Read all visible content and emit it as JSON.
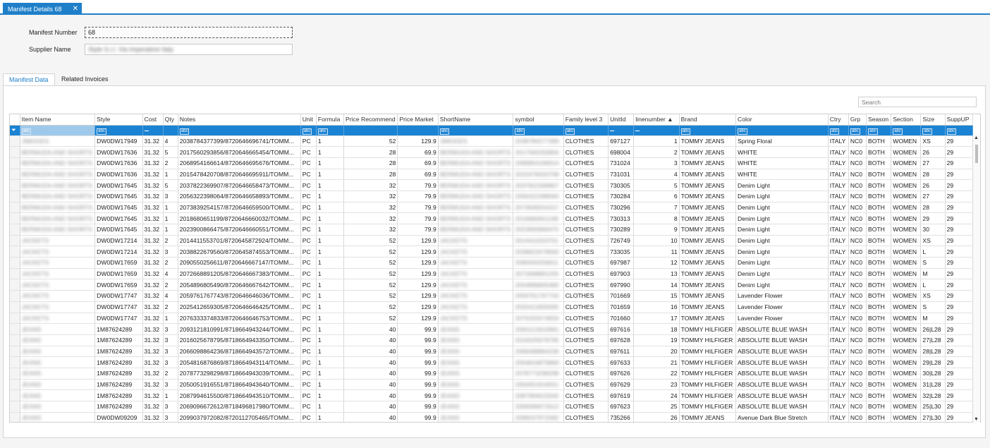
{
  "document_tab": {
    "label": "Manifest Details 68",
    "close": "✕"
  },
  "form": {
    "manifest_label": "Manifest Number",
    "manifest_value": "68",
    "supplier_label": "Supplier Name",
    "supplier_value": "Style S.r.l. Via Imperatore Italy"
  },
  "tabs": {
    "active": "Manifest Data",
    "inactive": "Related Invoices"
  },
  "search": {
    "placeholder": "Search"
  },
  "grid": {
    "columns": [
      "",
      "Item Name",
      "Style",
      "Cost",
      "Qty",
      "Notes",
      "Unit",
      "Formula",
      "Price Recommend",
      "Price Market",
      "ShortName",
      "symbol",
      "Family level 3",
      "UnitId",
      "linenumber ▲",
      "Brand",
      "Color",
      "Ctry",
      "Grp",
      "Season",
      "Section",
      "Size",
      "SuppUP"
    ],
    "filter_row": [
      "",
      "abc",
      "abc",
      "—",
      "",
      "abc",
      "abc",
      "abc",
      "",
      "",
      "abc",
      "abc",
      "abc",
      "—",
      "—",
      "abc",
      "abc",
      "abc",
      "abc",
      "abc",
      "abc",
      "abc",
      "abc"
    ],
    "rows": [
      [
        "",
        "JIMOGES",
        "DW0DW17949",
        "31.32",
        "4",
        "2038784377399/8720646696741/TOMM...",
        "PC",
        "1",
        "52",
        "129.9",
        "JIMOGES",
        "2038784377399",
        "CLOTHES",
        "697127",
        "1",
        "TOMMY JEANS",
        "Spring Floral",
        "ITALY",
        "NC0",
        "BOTH",
        "WOMEN",
        "XS",
        "29"
      ],
      [
        "",
        "BERMUDA AND SHORTS",
        "DW0DW17636",
        "31.32",
        "5",
        "2017560293856/8720646665454/TOMM...",
        "PC",
        "1",
        "28",
        "69.9",
        "BERMUDA AND SHORTS",
        "2017560293856",
        "CLOTHES",
        "698004",
        "2",
        "TOMMY JEANS",
        "WHITE",
        "ITALY",
        "NC0",
        "BOTH",
        "WOMEN",
        "26",
        "29"
      ],
      [
        "",
        "BERMUDA AND SHORTS",
        "DW0DW17636",
        "31.32",
        "2",
        "2068954166614/8720646695676/TOMM...",
        "PC",
        "1",
        "28",
        "69.9",
        "BERMUDA AND SHORTS",
        "2068954166614",
        "CLOTHES",
        "731024",
        "3",
        "TOMMY JEANS",
        "WHITE",
        "ITALY",
        "NC0",
        "BOTH",
        "WOMEN",
        "27",
        "29"
      ],
      [
        "",
        "BERMUDA AND SHORTS",
        "DW0DW17636",
        "31.32",
        "1",
        "2015478420708/8720646695911/TOMM...",
        "PC",
        "1",
        "28",
        "69.9",
        "BERMUDA AND SHORTS",
        "2015478420708",
        "CLOTHES",
        "731031",
        "4",
        "TOMMY JEANS",
        "WHITE",
        "ITALY",
        "NC0",
        "BOTH",
        "WOMEN",
        "28",
        "29"
      ],
      [
        "",
        "BERMUDA AND SHORTS",
        "DW0DW17645",
        "31.32",
        "5",
        "2037822369907/8720646658473/TOMM...",
        "PC",
        "1",
        "32",
        "79.9",
        "BERMUDA AND SHORTS",
        "2037822369907",
        "CLOTHES",
        "730305",
        "5",
        "TOMMY JEANS",
        "Denim Light",
        "ITALY",
        "NC0",
        "BOTH",
        "WOMEN",
        "26",
        "29"
      ],
      [
        "",
        "BERMUDA AND SHORTS",
        "DW0DW17645",
        "31.32",
        "3",
        "2056322398064/8720646658893/TOMM...",
        "PC",
        "1",
        "32",
        "79.9",
        "BERMUDA AND SHORTS",
        "2056322398064",
        "CLOTHES",
        "730284",
        "6",
        "TOMMY JEANS",
        "Denim Light",
        "ITALY",
        "NC0",
        "BOTH",
        "WOMEN",
        "27",
        "29"
      ],
      [
        "",
        "BERMUDA AND SHORTS",
        "DW0DW17645",
        "31.32",
        "1",
        "2073839254157/8720646659500/TOMM...",
        "PC",
        "1",
        "32",
        "79.9",
        "BERMUDA AND SHORTS",
        "2073839254157",
        "CLOTHES",
        "730296",
        "7",
        "TOMMY JEANS",
        "Denim Light",
        "ITALY",
        "NC0",
        "BOTH",
        "WOMEN",
        "28",
        "29"
      ],
      [
        "",
        "BERMUDA AND SHORTS",
        "DW0DW17645",
        "31.32",
        "1",
        "2018680651199/8720646660032/TOMM...",
        "PC",
        "1",
        "32",
        "79.9",
        "BERMUDA AND SHORTS",
        "2018680651199",
        "CLOTHES",
        "730313",
        "8",
        "TOMMY JEANS",
        "Denim Light",
        "ITALY",
        "NC0",
        "BOTH",
        "WOMEN",
        "29",
        "29"
      ],
      [
        "",
        "BERMUDA AND SHORTS",
        "DW0DW17645",
        "31.32",
        "1",
        "2023900866475/8720646660551/TOMM...",
        "PC",
        "1",
        "32",
        "79.9",
        "BERMUDA AND SHORTS",
        "2023900866475",
        "CLOTHES",
        "730289",
        "9",
        "TOMMY JEANS",
        "Denim Light",
        "ITALY",
        "NC0",
        "BOTH",
        "WOMEN",
        "30",
        "29"
      ],
      [
        "",
        "JACKETS",
        "DW0DW17214",
        "31.32",
        "2",
        "2014411553701/8720645872924/TOMM...",
        "PC",
        "1",
        "52",
        "129.9",
        "JACKETS",
        "2014411553701",
        "CLOTHES",
        "726749",
        "10",
        "TOMMY JEANS",
        "Denim Light",
        "ITALY",
        "NC0",
        "BOTH",
        "WOMEN",
        "XS",
        "29"
      ],
      [
        "",
        "JACKETS",
        "DW0DW17214",
        "31.32",
        "3",
        "2038822679560/8720645874553/TOMM...",
        "PC",
        "1",
        "52",
        "129.9",
        "JACKETS",
        "2038822679560",
        "CLOTHES",
        "733035",
        "11",
        "TOMMY JEANS",
        "Denim Light",
        "ITALY",
        "NC0",
        "BOTH",
        "WOMEN",
        "L",
        "29"
      ],
      [
        "",
        "JACKETS",
        "DW0DW17659",
        "31.32",
        "2",
        "2090550256611/8720646667147/TOMM...",
        "PC",
        "1",
        "52",
        "129.9",
        "JACKETS",
        "2090550256611",
        "CLOTHES",
        "697987",
        "12",
        "TOMMY JEANS",
        "Denim Light",
        "ITALY",
        "NC0",
        "BOTH",
        "WOMEN",
        "S",
        "29"
      ],
      [
        "",
        "JACKETS",
        "DW0DW17659",
        "31.32",
        "4",
        "2072668891205/8720646667383/TOMM...",
        "PC",
        "1",
        "52",
        "129.9",
        "JACKETS",
        "2072668891205",
        "CLOTHES",
        "697903",
        "13",
        "TOMMY JEANS",
        "Denim Light",
        "ITALY",
        "NC0",
        "BOTH",
        "WOMEN",
        "M",
        "29"
      ],
      [
        "",
        "JACKETS",
        "DW0DW17659",
        "31.32",
        "2",
        "2054896805490/8720646667642/TOMM...",
        "PC",
        "1",
        "52",
        "129.9",
        "JACKETS",
        "2054896805490",
        "CLOTHES",
        "697990",
        "14",
        "TOMMY JEANS",
        "Denim Light",
        "ITALY",
        "NC0",
        "BOTH",
        "WOMEN",
        "L",
        "29"
      ],
      [
        "",
        "JACKETS",
        "DW0DW17747",
        "31.32",
        "4",
        "2059761767743/8720646646036/TOMM...",
        "PC",
        "1",
        "52",
        "129.9",
        "JACKETS",
        "2059761767743",
        "CLOTHES",
        "701669",
        "15",
        "TOMMY JEANS",
        "Lavender Flower",
        "ITALY",
        "NC0",
        "BOTH",
        "WOMEN",
        "XS",
        "29"
      ],
      [
        "",
        "JACKETS",
        "DW0DW17747",
        "31.32",
        "2",
        "2025412659305/8720646646425/TOMM...",
        "PC",
        "1",
        "52",
        "129.9",
        "JACKETS",
        "2025412659305",
        "CLOTHES",
        "701659",
        "16",
        "TOMMY JEANS",
        "Lavender Flower",
        "ITALY",
        "NC0",
        "BOTH",
        "WOMEN",
        "S",
        "29"
      ],
      [
        "",
        "JACKETS",
        "DW0DW17747",
        "31.32",
        "1",
        "2076333374833/8720646646753/TOMM...",
        "PC",
        "1",
        "52",
        "129.9",
        "JACKETS",
        "2076333374833",
        "CLOTHES",
        "701660",
        "17",
        "TOMMY JEANS",
        "Lavender Flower",
        "ITALY",
        "NC0",
        "BOTH",
        "WOMEN",
        "M",
        "29"
      ],
      [
        "",
        "JEANS",
        "1M87624289",
        "31.32",
        "3",
        "2093121810991/8718664943244/TOMM...",
        "PC",
        "1",
        "40",
        "99.9",
        "JEANS",
        "2093121810991",
        "CLOTHES",
        "697616",
        "18",
        "TOMMY HILFIGER",
        "ABSOLUTE BLUE WASH",
        "ITALY",
        "NC0",
        "BOTH",
        "WOMEN",
        "26|L28",
        "29"
      ],
      [
        "",
        "JEANS",
        "1M87624289",
        "31.32",
        "3",
        "2016025678795/8718664943350/TOMM...",
        "PC",
        "1",
        "40",
        "99.9",
        "JEANS",
        "2016025678795",
        "CLOTHES",
        "697628",
        "19",
        "TOMMY HILFIGER",
        "ABSOLUTE BLUE WASH",
        "ITALY",
        "NC0",
        "BOTH",
        "WOMEN",
        "27|L28",
        "29"
      ],
      [
        "",
        "JEANS",
        "1M87624289",
        "31.32",
        "3",
        "2066098864236/8718664943572/TOMM...",
        "PC",
        "1",
        "40",
        "99.9",
        "JEANS",
        "2066098864236",
        "CLOTHES",
        "697611",
        "20",
        "TOMMY HILFIGER",
        "ABSOLUTE BLUE WASH",
        "ITALY",
        "NC0",
        "BOTH",
        "WOMEN",
        "28|L28",
        "29"
      ],
      [
        "",
        "JEANS",
        "1M87624289",
        "31.32",
        "3",
        "2054816876869/8718664943114/TOMM...",
        "PC",
        "1",
        "40",
        "99.9",
        "JEANS",
        "2054816876869",
        "CLOTHES",
        "697633",
        "21",
        "TOMMY HILFIGER",
        "ABSOLUTE BLUE WASH",
        "ITALY",
        "NC0",
        "BOTH",
        "WOMEN",
        "29|L28",
        "29"
      ],
      [
        "",
        "JEANS",
        "1M87624289",
        "31.32",
        "2",
        "2078773298298/8718664943039/TOMM...",
        "PC",
        "1",
        "40",
        "99.9",
        "JEANS",
        "2078773298298",
        "CLOTHES",
        "697626",
        "22",
        "TOMMY HILFIGER",
        "ABSOLUTE BLUE WASH",
        "ITALY",
        "NC0",
        "BOTH",
        "WOMEN",
        "30|L28",
        "29"
      ],
      [
        "",
        "JEANS",
        "1M87624289",
        "31.32",
        "3",
        "2050051916551/8718664943640/TOMM...",
        "PC",
        "1",
        "40",
        "99.9",
        "JEANS",
        "2050051916551",
        "CLOTHES",
        "697629",
        "23",
        "TOMMY HILFIGER",
        "ABSOLUTE BLUE WASH",
        "ITALY",
        "NC0",
        "BOTH",
        "WOMEN",
        "31|L28",
        "29"
      ],
      [
        "",
        "JEANS",
        "1M87624289",
        "31.32",
        "1",
        "2087994615500/8718664943510/TOMM...",
        "PC",
        "1",
        "40",
        "99.9",
        "JEANS",
        "2087994615500",
        "CLOTHES",
        "697619",
        "24",
        "TOMMY HILFIGER",
        "ABSOLUTE BLUE WASH",
        "ITALY",
        "NC0",
        "BOTH",
        "WOMEN",
        "32|L28",
        "29"
      ],
      [
        "",
        "JEANS",
        "1M87624289",
        "31.32",
        "3",
        "2069096672612/8718496817980/TOMM...",
        "PC",
        "1",
        "40",
        "99.9",
        "JEANS",
        "2069096672612",
        "CLOTHES",
        "697623",
        "25",
        "TOMMY HILFIGER",
        "ABSOLUTE BLUE WASH",
        "ITALY",
        "NC0",
        "BOTH",
        "WOMEN",
        "25|L30",
        "29"
      ],
      [
        "",
        "JEANS",
        "DW0DW09209",
        "31.32",
        "3",
        "2099037972082/8720112705465/TOMM...",
        "PC",
        "1",
        "40",
        "99.9",
        "JEANS",
        "2099037972082",
        "CLOTHES",
        "735266",
        "26",
        "TOMMY JEANS",
        "Avenue Dark Blue Stretch",
        "ITALY",
        "NC0",
        "BOTH",
        "WOMEN",
        "27|L30",
        "29"
      ]
    ]
  },
  "colors": {
    "accent": "#1f7fc9",
    "filter_row": "#1b83d3"
  },
  "icons": {
    "filter": "filter-icon",
    "sort_asc": "sort-ascending-icon",
    "scroll_up": "scroll-up-icon",
    "scroll_down": "scroll-down-icon"
  }
}
